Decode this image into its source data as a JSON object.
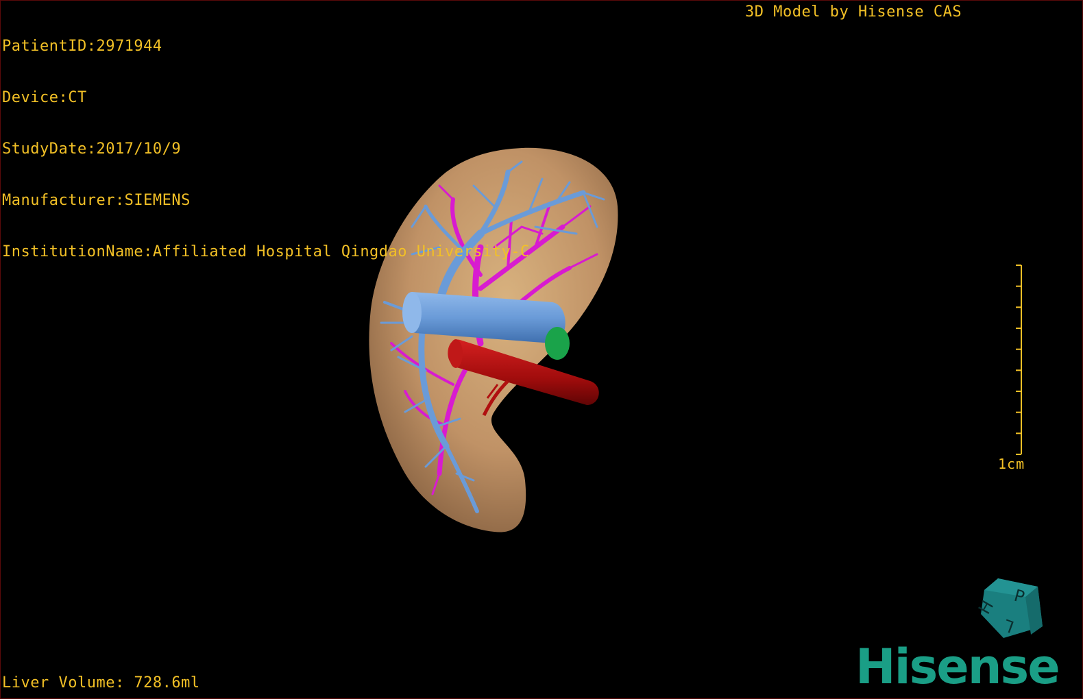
{
  "header": {
    "patient_id": "PatientID:2971944",
    "device": "Device:CT",
    "study_date": "StudyDate:2017/10/9",
    "manufacturer": "Manufacturer:SIEMENS",
    "institution": "InstitutionName:Affiliated Hospital Qingdao University-C",
    "model_credit": "3D Model by Hisense CAS"
  },
  "footer": {
    "liver_volume": "Liver Volume: 728.6ml"
  },
  "scale": {
    "label": "1cm",
    "tick_count": 10
  },
  "orientation_cube": {
    "faces": [
      "P",
      "H",
      "L"
    ]
  },
  "brand": {
    "logo_text": "Hisense"
  },
  "colors": {
    "overlay_text": "#f2c026",
    "liver": "#c49a6c",
    "hepatic_vein": "#6a9bd8",
    "portal_vein": "#d81bd0",
    "artery": "#b01010",
    "gallbladder": "#1aa34a",
    "brand": "#1a9e86",
    "cube": "#1a7f7f"
  }
}
